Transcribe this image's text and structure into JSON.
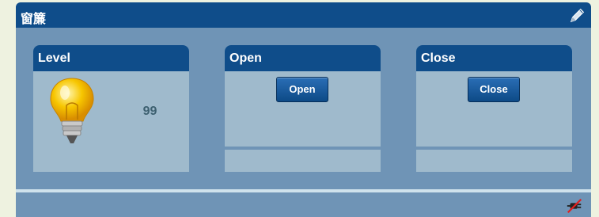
{
  "widget": {
    "title": "窗簾",
    "edit_icon": "pencil-icon",
    "footer_icon": "disconnected-plug-icon"
  },
  "panels": [
    {
      "title": "Level",
      "value": "99",
      "icon": "light-bulb-icon"
    },
    {
      "title": "Open",
      "button_label": "Open"
    },
    {
      "title": "Close",
      "button_label": "Close"
    }
  ],
  "colors": {
    "header": "#0f4d8a",
    "widget_bg": "#6f94b6",
    "panel_bg": "#9fbacc",
    "button": "#1f5f9f",
    "bulb": "#f5c200"
  }
}
